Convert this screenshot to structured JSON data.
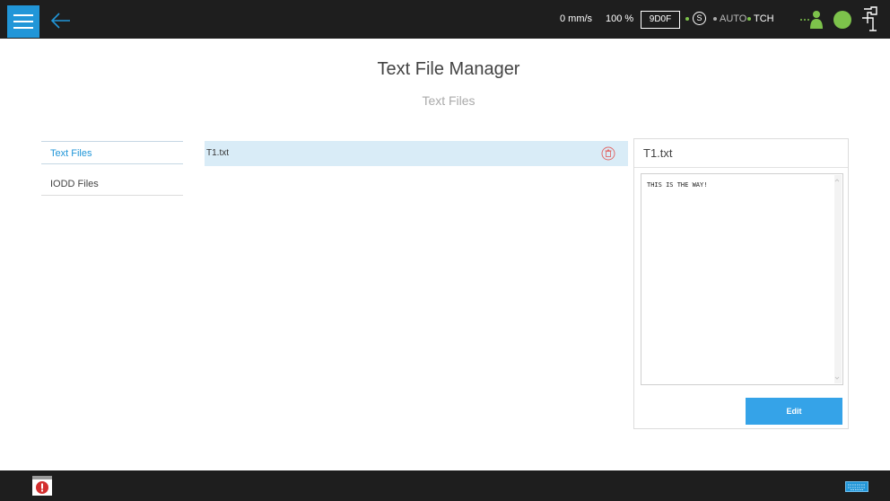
{
  "topbar": {
    "speed": "0 mm/s",
    "speed_override": "100 %",
    "dof_mode": "9D0F",
    "mode_s_label": "S",
    "mode_auto": "AUTO",
    "mode_tch": "TCH",
    "status_color_accent": "#7dc24b",
    "icons": [
      "menu-icon",
      "back-arrow-icon",
      "person-icon",
      "status-circle",
      "robot-arm-icon"
    ]
  },
  "page": {
    "title": "Text File Manager",
    "subtitle": "Text Files"
  },
  "sidebar": {
    "items": [
      {
        "label": "Text Files",
        "active": true
      },
      {
        "label": "IODD Files",
        "active": false
      }
    ]
  },
  "files": {
    "items": [
      {
        "name": "T1.txt",
        "selected": true
      }
    ]
  },
  "preview": {
    "filename": "T1.txt",
    "content": "THIS IS THE WAY!",
    "edit_label": "Edit"
  },
  "bottombar": {
    "icons": [
      "alert-icon",
      "keyboard-icon"
    ]
  },
  "colors": {
    "accent": "#2196d8",
    "button": "#35a3e8",
    "selected_row": "#d9ecf7",
    "bar": "#1e1e1e"
  }
}
